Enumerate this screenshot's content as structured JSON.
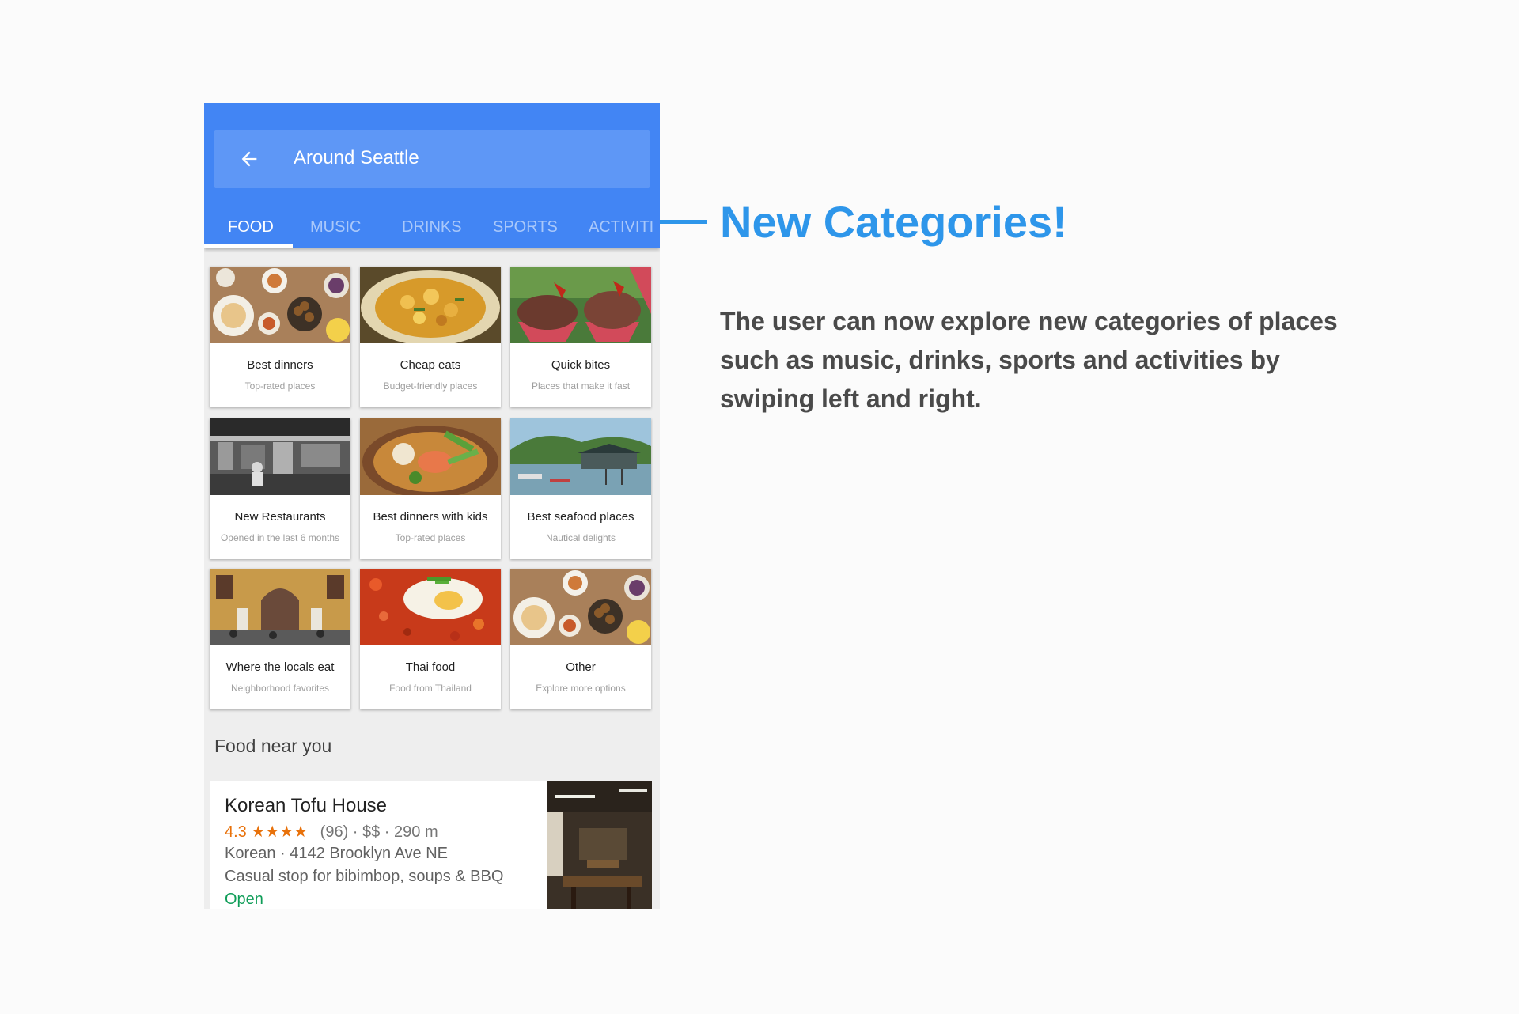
{
  "app_bar": {
    "search_title": "Around Seattle",
    "tabs": [
      {
        "label": "FOOD",
        "active": true
      },
      {
        "label": "MUSIC",
        "active": false
      },
      {
        "label": "DRINKS",
        "active": false
      },
      {
        "label": "SPORTS",
        "active": false
      },
      {
        "label": "ACTIVITI",
        "active": false
      }
    ]
  },
  "categories": [
    {
      "title": "Best dinners",
      "subtitle": "Top-rated places"
    },
    {
      "title": "Cheap eats",
      "subtitle": "Budget-friendly places"
    },
    {
      "title": "Quick bites",
      "subtitle": "Places that make it fast"
    },
    {
      "title": "New Restaurants",
      "subtitle": "Opened in the last 6 months"
    },
    {
      "title": "Best dinners with kids",
      "subtitle": "Top-rated places"
    },
    {
      "title": "Best seafood places",
      "subtitle": "Nautical delights"
    },
    {
      "title": "Where the locals eat",
      "subtitle": "Neighborhood favorites"
    },
    {
      "title": "Thai food",
      "subtitle": "Food from Thailand"
    },
    {
      "title": "Other",
      "subtitle": "Explore more options"
    }
  ],
  "nearby": {
    "section_title": "Food near you",
    "place": {
      "name": "Korean Tofu House",
      "rating": "4.3",
      "stars": "★★★★",
      "details": "(96) · $$ · 290 m",
      "address": "Korean · 4142 Brooklyn Ave NE",
      "description": "Casual stop for bibimbop, soups & BBQ",
      "status": "Open"
    }
  },
  "annotation": {
    "headline": "New Categories!",
    "description": "The user can now explore new categories of places such as music, drinks, sports and activities by swiping left and right."
  },
  "colors": {
    "app_bar": "#4285f4",
    "search_bar": "#5e97f6",
    "accent_annotation": "#2e96ea",
    "rating": "#e8710a",
    "open_status": "#0f9d58"
  },
  "icons": {
    "back": "arrow-back-icon"
  }
}
